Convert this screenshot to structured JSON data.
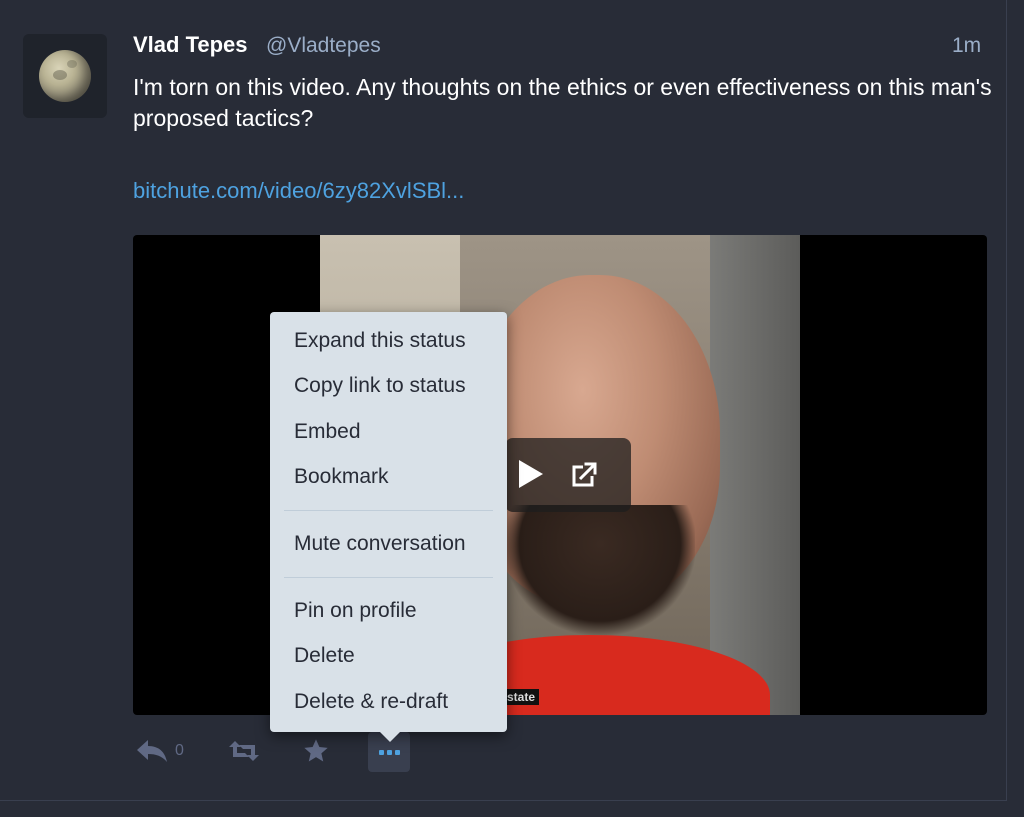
{
  "status": {
    "display_name": "Vlad Tepes",
    "account": "@Vladtepes",
    "timestamp": "1m",
    "content": "I'm torn on this video. Any thoughts on the ethics or even effectiveness on this man's proposed tactics?",
    "link_text": "bitchute.com/video/6zy82XvlSBl...",
    "video_caption": "state"
  },
  "actions": {
    "reply_count": "0",
    "icons": [
      "reply-icon",
      "boost-icon",
      "favourite-icon",
      "more-icon"
    ]
  },
  "menu": {
    "items": [
      {
        "label": "Expand this status"
      },
      {
        "label": "Copy link to status"
      },
      {
        "label": "Embed"
      },
      {
        "label": "Bookmark"
      },
      {
        "label": "Mute conversation"
      },
      {
        "label": "Pin on profile"
      },
      {
        "label": "Delete"
      },
      {
        "label": "Delete & re-draft"
      }
    ]
  },
  "colors": {
    "background": "#282c37",
    "secondary_text": "#9baec8",
    "link": "#4ea2e0",
    "menu_bg": "#d9e1e8",
    "action_icon": "#606984"
  }
}
